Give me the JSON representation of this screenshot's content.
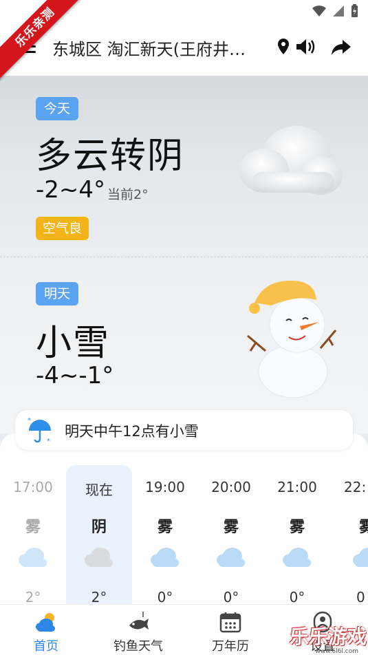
{
  "badge": {
    "text": "乐乐亲测"
  },
  "header": {
    "location": "东城区 淘汇新天(王府井…"
  },
  "today": {
    "tag": "今天",
    "condition": "多云转阴",
    "temp_range": "-2~4°",
    "current": "当前2°",
    "aqi": "空气良"
  },
  "tomorrow": {
    "tag": "明天",
    "condition": "小雪",
    "temp_range": "-4~-1°"
  },
  "alert": {
    "text": "明天中午12点有小雪",
    "icon": "umbrella-snow-icon"
  },
  "hourly": [
    {
      "time": "17:00",
      "condition": "雾",
      "temp": "2°",
      "state": "past"
    },
    {
      "time": "现在",
      "condition": "阴",
      "temp": "2°",
      "state": "now"
    },
    {
      "time": "19:00",
      "condition": "雾",
      "temp": "0°",
      "state": "future"
    },
    {
      "time": "20:00",
      "condition": "雾",
      "temp": "0°",
      "state": "future"
    },
    {
      "time": "21:00",
      "condition": "雾",
      "temp": "0°",
      "state": "future"
    },
    {
      "time": "22:",
      "condition": "雾",
      "temp": "0",
      "state": "future"
    }
  ],
  "nav": {
    "items": [
      {
        "label": "首页",
        "icon": "weather-home-icon",
        "active": true
      },
      {
        "label": "钓鱼天气",
        "icon": "fishing-icon",
        "active": false
      },
      {
        "label": "万年历",
        "icon": "calendar-icon",
        "active": false
      },
      {
        "label": "设置",
        "icon": "profile-icon",
        "active": false
      }
    ]
  },
  "watermark": {
    "text": "乐乐游戏",
    "sub": "www.6l6l.com"
  },
  "colors": {
    "accent": "#2e86e6",
    "tag_blue": "#5aa3f0",
    "aqi_yellow": "#f2b418",
    "ribbon_red": "#d4151c"
  }
}
